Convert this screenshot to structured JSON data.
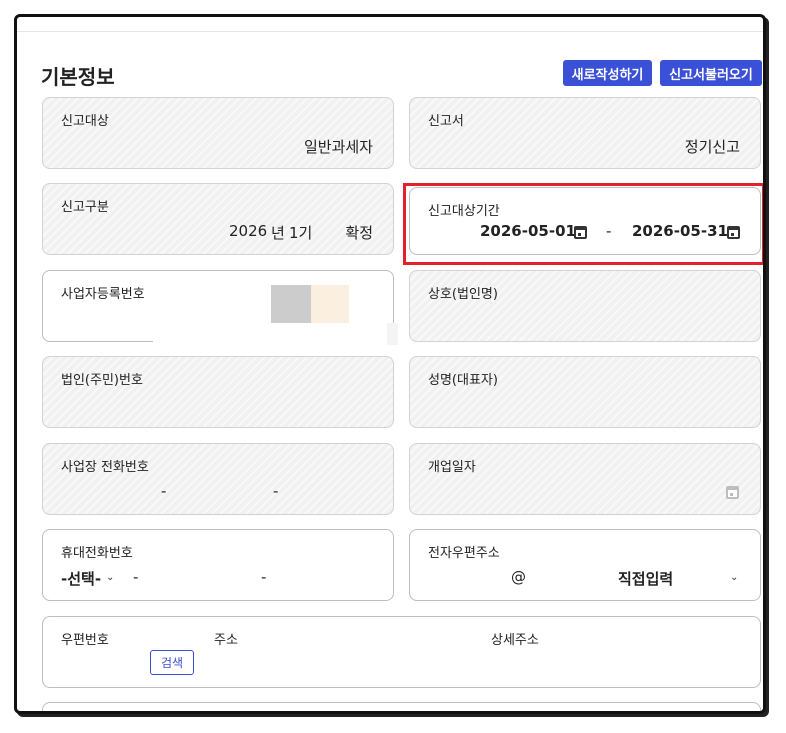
{
  "section": {
    "title": "기본정보"
  },
  "toolbar": {
    "new_label": "새로작성하기",
    "load_label": "신고서불러오기"
  },
  "fields": {
    "target": {
      "label": "신고대상",
      "value": "일반과세자"
    },
    "form": {
      "label": "신고서",
      "value": "정기신고"
    },
    "category": {
      "label": "신고구분",
      "year": "2026",
      "year_unit": "년",
      "term": "1기",
      "status": "확정"
    },
    "period": {
      "label": "신고대상기간",
      "start": "2026-05-01",
      "separator": "-",
      "end": "2026-05-31"
    },
    "business_no": {
      "label": "사업자등록번호"
    },
    "company_name": {
      "label": "상호(법인명)"
    },
    "corp_no": {
      "label": "법인(주민)번호"
    },
    "rep_name": {
      "label": "성명(대표자)"
    },
    "biz_phone": {
      "label": "사업장 전화번호",
      "sep1": "-",
      "sep2": "-"
    },
    "open_date": {
      "label": "개업일자"
    },
    "mobile": {
      "label": "휴대전화번호",
      "carrier": "-선택-",
      "sep1": "-",
      "sep2": "-"
    },
    "email": {
      "label": "전자우편주소",
      "at": "@",
      "domain_option": "직접입력"
    },
    "address": {
      "zip_label": "우편번호",
      "addr_label": "주소",
      "detail_label": "상세주소",
      "search_label": "검색"
    }
  },
  "colors": {
    "accent": "#3a50d6",
    "highlight": "#e5202a",
    "card_bg": "#f1f1f1"
  },
  "icons": {
    "date_picker": "calendar-icon",
    "dropdown": "chevron-down-icon"
  }
}
